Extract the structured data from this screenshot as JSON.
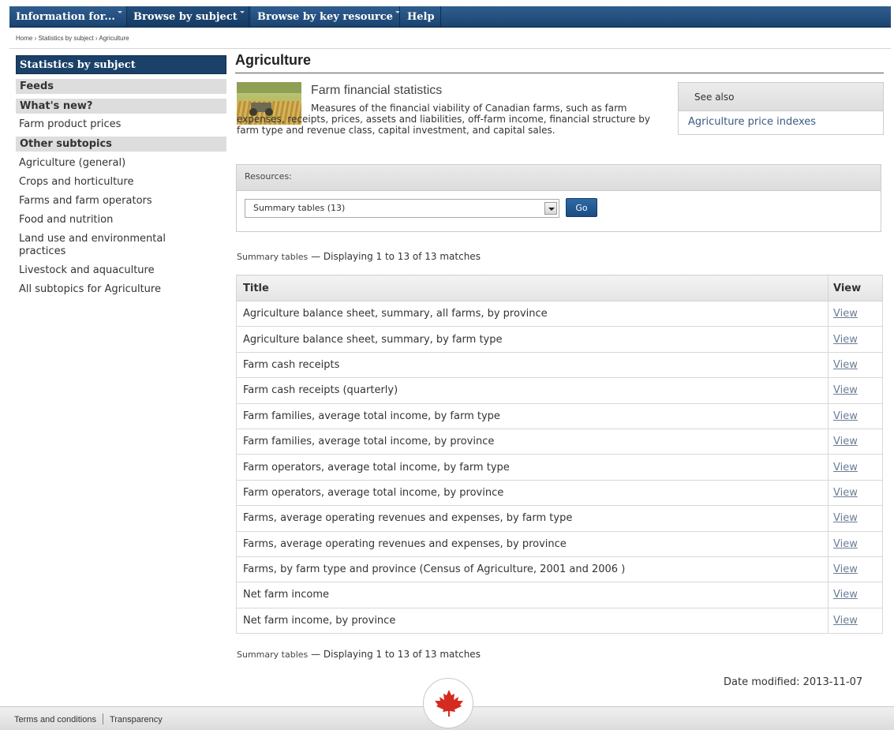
{
  "topnav": {
    "items": [
      "Information for...",
      "Browse by subject",
      "Browse by key resource",
      "Help"
    ]
  },
  "breadcrumb": "Home › Statistics by subject › Agriculture",
  "sidebar": {
    "title": "Statistics by subject",
    "feeds": "Feeds",
    "whats_new": "What's new?",
    "farm_prices": "Farm product prices",
    "other_subtopics": "Other subtopics",
    "links": [
      "Agriculture (general)",
      "Crops and horticulture",
      "Farms and farm operators",
      "Food and nutrition",
      "Land use and environmental practices",
      "Livestock and aquaculture",
      "All subtopics for Agriculture"
    ]
  },
  "page_title": "Agriculture",
  "feature": {
    "title": "Farm financial statistics",
    "description": "Measures of the financial viability of Canadian farms, such as farm expenses, receipts, prices, assets and liabilities, off-farm income, financial structure by farm type and revenue class, capital investment, and capital sales."
  },
  "see_also": {
    "title": "See also",
    "link": "Agriculture price indexes"
  },
  "resources": {
    "label": "Resources:",
    "selected": "Summary tables (13)",
    "go": "Go"
  },
  "summary": {
    "label": "Summary tables",
    "text": "— Displaying 1 to 13 of 13  matches"
  },
  "table": {
    "headers": [
      "Title",
      "View"
    ],
    "view_label": "View",
    "rows": [
      "Agriculture balance sheet, summary, all farms, by province",
      "Agriculture balance sheet, summary, by farm type",
      "Farm cash receipts",
      "Farm cash receipts (quarterly)",
      "Farm families, average total income, by farm type",
      "Farm families, average total income, by province",
      "Farm operators, average total income, by farm type",
      "Farm operators, average total income, by province",
      "Farms, average operating revenues and expenses, by farm type",
      "Farms, average operating revenues and expenses, by province",
      "Farms, by farm type and province (Census of Agriculture, 2001 and 2006 )",
      "Net farm income",
      "Net farm income, by province"
    ]
  },
  "date_modified": "Date modified:  2013-11-07",
  "footer": {
    "terms": "Terms and conditions",
    "transparency": "Transparency"
  },
  "colors": {
    "nav": "#1c4571",
    "sidebar_head": "#1b4169",
    "leaf": "#d52b1e"
  },
  "icons": {
    "footer_logo": "maple-leaf-icon",
    "dropdown": "dropdown-arrow-icon"
  }
}
